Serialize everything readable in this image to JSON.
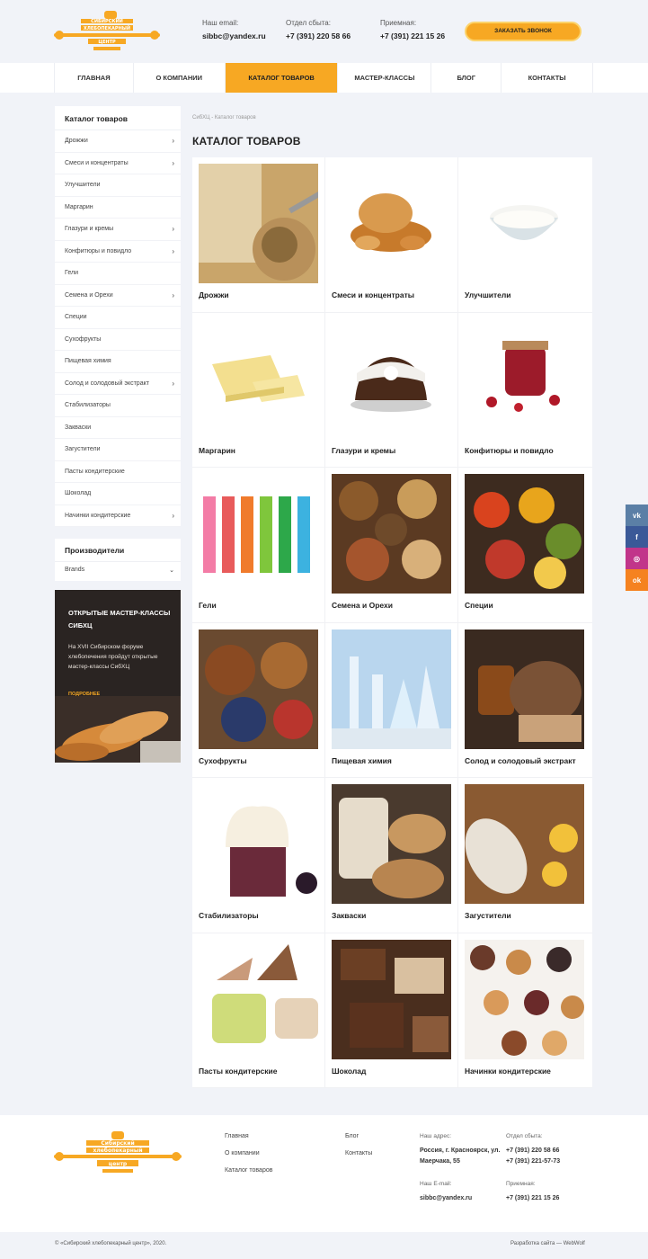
{
  "header": {
    "logo_text": "СИБИРСКИЙ ХЛЕБОПЕКАРНЫЙ ЦЕНТР",
    "email_label": "Наш email:",
    "email": "sibbc@yandex.ru",
    "sales_label": "Отдел сбыта:",
    "sales_phone": "+7 (391) 220 58 66",
    "reception_label": "Приемная:",
    "reception_phone": "+7 (391) 221 15 26",
    "call_button": "Заказать звонок"
  },
  "nav": {
    "items": [
      {
        "label": "Главная"
      },
      {
        "label": "О компании"
      },
      {
        "label": "Каталог товаров"
      },
      {
        "label": "Мастер-классы"
      },
      {
        "label": "Блог"
      },
      {
        "label": "Контакты"
      }
    ],
    "active_index": 2
  },
  "sidebar": {
    "title": "Каталог товаров",
    "items": [
      {
        "label": "Дрожжи",
        "has_sub": true
      },
      {
        "label": "Смеси и концентраты",
        "has_sub": true
      },
      {
        "label": "Улучшители",
        "has_sub": false
      },
      {
        "label": "Маргарин",
        "has_sub": false
      },
      {
        "label": "Глазури и кремы",
        "has_sub": true
      },
      {
        "label": "Конфитюры и повидло",
        "has_sub": true
      },
      {
        "label": "Гели",
        "has_sub": false
      },
      {
        "label": "Семена и Орехи",
        "has_sub": true
      },
      {
        "label": "Специи",
        "has_sub": false
      },
      {
        "label": "Сухофрукты",
        "has_sub": false
      },
      {
        "label": "Пищевая химия",
        "has_sub": false
      },
      {
        "label": "Солод и солодовый экстракт",
        "has_sub": true
      },
      {
        "label": "Стабилизаторы",
        "has_sub": false
      },
      {
        "label": "Закваски",
        "has_sub": false
      },
      {
        "label": "Загустители",
        "has_sub": false
      },
      {
        "label": "Пасты кондитерские",
        "has_sub": false
      },
      {
        "label": "Шоколад",
        "has_sub": false
      },
      {
        "label": "Начинки кондитерские",
        "has_sub": true
      }
    ],
    "makers_title": "Производители",
    "makers_select": "Brands"
  },
  "promo": {
    "title": "Открытые мастер-классы СибХЦ",
    "text": "На XVII Сибирском форуме хлебопечения пройдут открытые мастер-классы СибХЦ",
    "link": "Подробнее"
  },
  "main": {
    "breadcrumb": "СибХЦ - Каталог товаров",
    "title": "Каталог товаров",
    "cards": [
      {
        "name": "Дрожжи",
        "icon": "yeast-image"
      },
      {
        "name": "Смеси и концентраты",
        "icon": "bread-basket-image"
      },
      {
        "name": "Улучшители",
        "icon": "cream-bowl-image"
      },
      {
        "name": "Маргарин",
        "icon": "margarine-image"
      },
      {
        "name": "Глазури и кремы",
        "icon": "glazed-cake-image"
      },
      {
        "name": "Конфитюры и повидло",
        "icon": "jam-jar-image"
      },
      {
        "name": "Гели",
        "icon": "gel-tubes-image"
      },
      {
        "name": "Семена и Орехи",
        "icon": "nuts-image"
      },
      {
        "name": "Специи",
        "icon": "spices-image"
      },
      {
        "name": "Сухофрукты",
        "icon": "dried-fruits-image"
      },
      {
        "name": "Пищевая химия",
        "icon": "lab-glassware-image"
      },
      {
        "name": "Солод и солодовый экстракт",
        "icon": "malt-image"
      },
      {
        "name": "Стабилизаторы",
        "icon": "whipped-cream-image"
      },
      {
        "name": "Закваски",
        "icon": "sourdough-image"
      },
      {
        "name": "Загустители",
        "icon": "thickener-image"
      },
      {
        "name": "Пасты кондитерские",
        "icon": "pastry-paste-image"
      },
      {
        "name": "Шоколад",
        "icon": "chocolate-image"
      },
      {
        "name": "Начинки кондитерские",
        "icon": "tartlets-image"
      }
    ]
  },
  "social": [
    {
      "label": "vk",
      "color": "#5b7fa6"
    },
    {
      "label": "f",
      "color": "#3b5998"
    },
    {
      "label": "◎",
      "color": "#c1358a"
    },
    {
      "label": "ok",
      "color": "#f58220"
    }
  ],
  "footer": {
    "links_col1": [
      "Главная",
      "О компании",
      "Каталог товаров"
    ],
    "links_col2": [
      "Блог",
      "Контакты"
    ],
    "address_label": "Наш адрес:",
    "address": "Россия, г. Красноярск, ул. Маерчака, 55",
    "sales_label": "Отдел сбыта:",
    "sales_phones": "+7 (391) 220 58 66\n+7 (391) 221-57-73",
    "email_label": "Наш E-mail:",
    "email": "sibbc@yandex.ru",
    "reception_label": "Приемная:",
    "reception_phone": "+7 (391) 221 15 26",
    "copyright": "© «Сибирский хлебопекарный центр», 2020.",
    "developer": "Разработка сайта — WebWolf"
  },
  "colors": {
    "accent": "#f7a823",
    "background": "#f1f3f8"
  }
}
